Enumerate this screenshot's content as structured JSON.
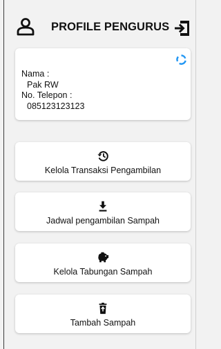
{
  "header": {
    "title": "PROFILE PENGURUS",
    "user_icon": "user-icon",
    "logout_icon": "logout-icon"
  },
  "profile": {
    "refresh_icon": "refresh-icon",
    "name_label": "Nama :",
    "name_value": "Pak RW",
    "phone_label": "No. Telepon :",
    "phone_value": "085123123123"
  },
  "actions": [
    {
      "label": "Kelola Transaksi Pengambilan",
      "icon": "history-icon"
    },
    {
      "label": "Jadwal pengambilan Sampah",
      "icon": "download-icon"
    },
    {
      "label": "Kelola Tabungan Sampah",
      "icon": "piggy-bank-icon"
    },
    {
      "label": "Tambah Sampah",
      "icon": "trash-icon"
    }
  ],
  "colors": {
    "accent": "#2196f3",
    "background": "#f2f2f2",
    "card": "#ffffff"
  }
}
